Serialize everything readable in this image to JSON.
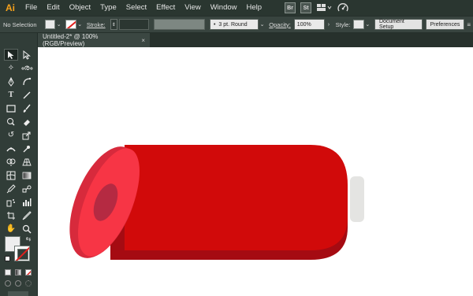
{
  "app": {
    "logo": "Ai",
    "menu": [
      "File",
      "Edit",
      "Object",
      "Type",
      "Select",
      "Effect",
      "View",
      "Window",
      "Help"
    ],
    "bridge_label": "Br",
    "stock_label": "St"
  },
  "controlbar": {
    "selection_status": "No Selection",
    "stroke_label": "Stroke:",
    "brush_value": "3 pt. Round",
    "opacity_label": "Opacity:",
    "opacity_value": "100%",
    "style_label": "Style:",
    "document_setup": "Document Setup",
    "preferences": "Preferences"
  },
  "document": {
    "tab_title": "Untitled-2* @ 100% (RGB/Preview)",
    "tab_close": "×"
  },
  "tools": [
    "selection-tool",
    "direct-selection-tool",
    "magic-wand-tool",
    "lasso-tool",
    "pen-tool",
    "curvature-tool",
    "type-tool",
    "line-segment-tool",
    "rectangle-tool",
    "paintbrush-tool",
    "shaper-tool",
    "eraser-tool",
    "rotate-tool",
    "scale-tool",
    "width-tool",
    "puppet-warp-tool",
    "shape-builder-tool",
    "perspective-grid-tool",
    "mesh-tool",
    "gradient-tool",
    "eyedropper-tool",
    "blend-tool",
    "symbol-sprayer-tool",
    "column-graph-tool",
    "artboard-tool",
    "slice-tool",
    "hand-tool",
    "zoom-tool"
  ],
  "colors": {
    "cylinder_body": "#d10a0a",
    "cylinder_shadow": "#a50b12",
    "cylinder_face": "#f73545",
    "cylinder_face_edge": "#d72a3c",
    "cylinder_hole": "#b52a42",
    "cap": "#e4e4e2"
  }
}
